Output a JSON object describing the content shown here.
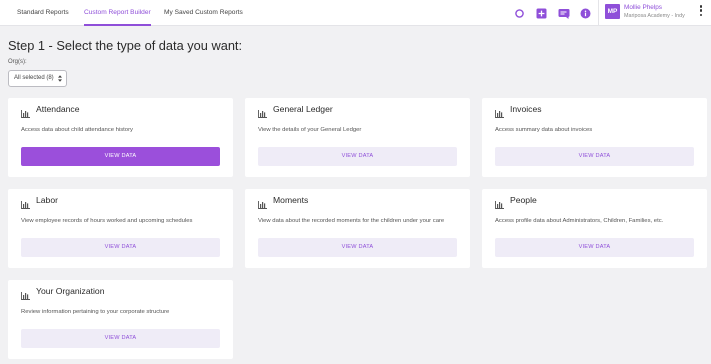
{
  "nav": {
    "tabs": [
      {
        "label": "Standard Reports",
        "active": false
      },
      {
        "label": "Custom Report Builder",
        "active": true
      },
      {
        "label": "My Saved Custom Reports",
        "active": false
      }
    ],
    "icons": [
      "circle-icon",
      "plus-icon",
      "chat-icon",
      "info-icon"
    ]
  },
  "user": {
    "initials": "MP",
    "name": "Mollie Phelps",
    "org": "Mariposa Academy - Indy"
  },
  "main": {
    "title": "Step 1 - Select the type of data you want:",
    "org_label": "Org(s):",
    "org_select_value": "All selected (8)"
  },
  "cards": [
    {
      "title": "Attendance",
      "description": "Access data about child attendance history",
      "button": "VIEW DATA",
      "primary": true
    },
    {
      "title": "General Ledger",
      "description": "View the details of your General Ledger",
      "button": "VIEW DATA",
      "primary": false
    },
    {
      "title": "Invoices",
      "description": "Access summary data about invoices",
      "button": "VIEW DATA",
      "primary": false
    },
    {
      "title": "Labor",
      "description": "View employee records of hours worked and upcoming schedules",
      "button": "VIEW DATA",
      "primary": false
    },
    {
      "title": "Moments",
      "description": "View data about the recorded moments for the children under your care",
      "button": "VIEW DATA",
      "primary": false
    },
    {
      "title": "People",
      "description": "Access profile data about Administrators, Children, Families, etc.",
      "button": "VIEW DATA",
      "primary": false
    },
    {
      "title": "Your Organization",
      "description": "Review information pertaining to your corporate structure",
      "button": "VIEW DATA",
      "primary": false
    }
  ],
  "colors": {
    "accent": "#8f4fd9",
    "primary_button": "#9b4fdb",
    "secondary_button_bg": "#efecf7",
    "page_bg": "#f1f1f3"
  }
}
